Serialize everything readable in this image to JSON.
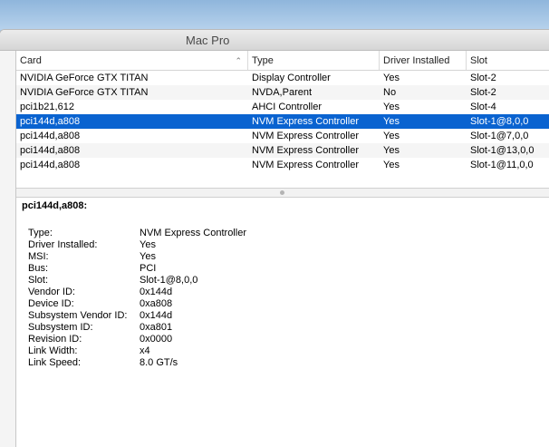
{
  "window": {
    "title": "Mac Pro"
  },
  "table": {
    "columns": [
      "Card",
      "Type",
      "Driver Installed",
      "Slot"
    ],
    "rows": [
      [
        "NVIDIA GeForce GTX TITAN",
        "Display Controller",
        "Yes",
        "Slot-2"
      ],
      [
        "NVIDIA GeForce GTX TITAN",
        "NVDA,Parent",
        "No",
        "Slot-2"
      ],
      [
        "pci1b21,612",
        "AHCI Controller",
        "Yes",
        "Slot-4"
      ],
      [
        "pci144d,a808",
        "NVM Express Controller",
        "Yes",
        "Slot-1@8,0,0"
      ],
      [
        "pci144d,a808",
        "NVM Express Controller",
        "Yes",
        "Slot-1@7,0,0"
      ],
      [
        "pci144d,a808",
        "NVM Express Controller",
        "Yes",
        "Slot-1@13,0,0"
      ],
      [
        "pci144d,a808",
        "NVM Express Controller",
        "Yes",
        "Slot-1@11,0,0"
      ]
    ],
    "selected_index": 3,
    "sort": {
      "column": "Card",
      "icon": "chevron-up-icon"
    }
  },
  "details": {
    "title": "pci144d,a808:",
    "fields": [
      {
        "label": "Type:",
        "value": "NVM Express Controller"
      },
      {
        "label": "Driver Installed:",
        "value": "Yes"
      },
      {
        "label": "MSI:",
        "value": "Yes"
      },
      {
        "label": "Bus:",
        "value": "PCI"
      },
      {
        "label": "Slot:",
        "value": "Slot-1@8,0,0"
      },
      {
        "label": "Vendor ID:",
        "value": "0x144d"
      },
      {
        "label": "Device ID:",
        "value": "0xa808"
      },
      {
        "label": "Subsystem Vendor ID:",
        "value": "0x144d"
      },
      {
        "label": "Subsystem ID:",
        "value": "0xa801"
      },
      {
        "label": "Revision ID:",
        "value": "0x0000"
      },
      {
        "label": "Link Width:",
        "value": "x4"
      },
      {
        "label": "Link Speed:",
        "value": "8.0 GT/s"
      }
    ]
  },
  "colors": {
    "selection": "#0a63d0",
    "accent_desktop": "#a9c8e6"
  }
}
